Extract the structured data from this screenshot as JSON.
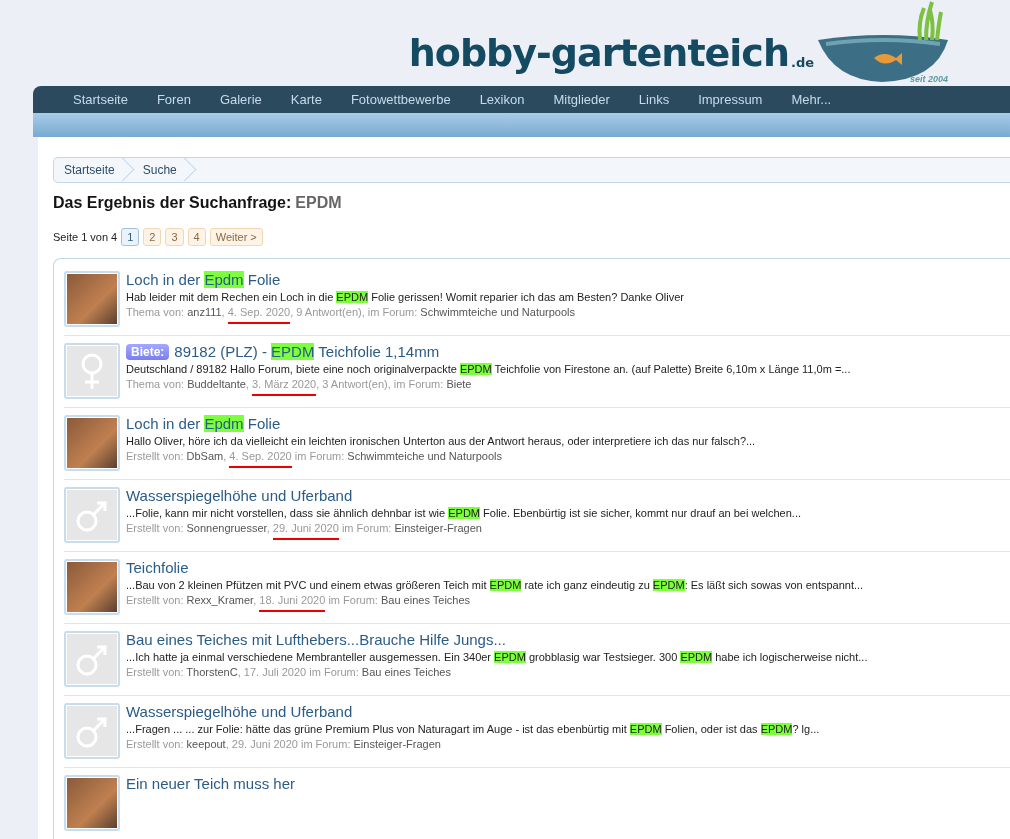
{
  "logo": {
    "name": "hobby-gartenteich",
    "tld": ".de",
    "since": "seit 2004"
  },
  "nav": [
    "Startseite",
    "Foren",
    "Galerie",
    "Karte",
    "Fotowettbewerbe",
    "Lexikon",
    "Mitglieder",
    "Links",
    "Impressum",
    "Mehr..."
  ],
  "breadcrumb": [
    "Startseite",
    "Suche"
  ],
  "heading": {
    "label": "Das Ergebnis der Suchanfrage:",
    "query": "EPDM"
  },
  "pagination": {
    "label": "Seite 1 von 4",
    "pages": [
      {
        "label": "1",
        "selected": true
      },
      {
        "label": "2",
        "selected": false
      },
      {
        "label": "3",
        "selected": false
      },
      {
        "label": "4",
        "selected": false
      }
    ],
    "next": "Weiter >"
  },
  "results": [
    {
      "kind": "photo",
      "title": [
        {
          "text": "Loch in der ",
          "highlight": false
        },
        {
          "text": "Epdm",
          "highlight": true
        },
        {
          "text": " Folie",
          "highlight": false
        }
      ],
      "snippet": [
        {
          "text": "Hab leider mit dem Rechen ein Loch in die ",
          "highlight": false
        },
        {
          "text": "EPDM",
          "highlight": true
        },
        {
          "text": " Folie gerissen! Womit reparier ich das am Besten? Danke Oliver",
          "highlight": false
        }
      ],
      "meta": [
        {
          "kind": "label",
          "text": "Thema von: "
        },
        {
          "kind": "user",
          "text": "anz111"
        },
        {
          "kind": "label",
          "text": ", "
        },
        {
          "kind": "date",
          "text": "4. Sep. 2020",
          "underlined": true
        },
        {
          "kind": "label",
          "text": ", 9 Antwort(en), im Forum: "
        },
        {
          "kind": "forum",
          "text": "Schwimmteiche und Naturpools"
        }
      ]
    },
    {
      "kind": "female",
      "badge": "Biete:",
      "title": [
        {
          "text": "89182 (PLZ) - ",
          "highlight": false
        },
        {
          "text": "EPDM",
          "highlight": true
        },
        {
          "text": " Teichfolie 1,14mm",
          "highlight": false
        }
      ],
      "snippet": [
        {
          "text": "Deutschland / 89182 Hallo Forum, biete eine noch originalverpackte ",
          "highlight": false
        },
        {
          "text": "EPDM",
          "highlight": true
        },
        {
          "text": " Teichfolie von Firestone an. (auf Palette) Breite 6,10m x Länge 11,0m =...",
          "highlight": false
        }
      ],
      "meta": [
        {
          "kind": "label",
          "text": "Thema von: "
        },
        {
          "kind": "user",
          "text": "Buddeltante"
        },
        {
          "kind": "label",
          "text": ", "
        },
        {
          "kind": "date",
          "text": "3. März 2020",
          "underlined": true
        },
        {
          "kind": "label",
          "text": ", 3 Antwort(en), im Forum: "
        },
        {
          "kind": "forum",
          "text": "Biete"
        }
      ]
    },
    {
      "kind": "photo",
      "title": [
        {
          "text": "Loch in der ",
          "highlight": false
        },
        {
          "text": "Epdm",
          "highlight": true
        },
        {
          "text": " Folie",
          "highlight": false
        }
      ],
      "snippet": [
        {
          "text": "Hallo Oliver, höre ich da vielleicht ein leichten ironischen Unterton aus der Antwort heraus, oder interpretiere ich das nur falsch?...",
          "highlight": false
        }
      ],
      "meta": [
        {
          "kind": "label",
          "text": "Erstellt von: "
        },
        {
          "kind": "user",
          "text": "DbSam"
        },
        {
          "kind": "label",
          "text": ", "
        },
        {
          "kind": "date",
          "text": "4. Sep. 2020",
          "underlined": true
        },
        {
          "kind": "label",
          "text": " im Forum: "
        },
        {
          "kind": "forum",
          "text": "Schwimmteiche und Naturpools"
        }
      ]
    },
    {
      "kind": "male",
      "title": [
        {
          "text": "Wasserspiegelhöhe und Uferband",
          "highlight": false
        }
      ],
      "snippet": [
        {
          "text": "...Folie, kann mir nicht vorstellen, dass sie ähnlich dehnbar ist wie ",
          "highlight": false
        },
        {
          "text": "EPDM",
          "highlight": true
        },
        {
          "text": " Folie. Ebenbürtig ist sie sicher, kommt nur drauf an bei welchen...",
          "highlight": false
        }
      ],
      "meta": [
        {
          "kind": "label",
          "text": "Erstellt von: "
        },
        {
          "kind": "user",
          "text": "Sonnengruesser"
        },
        {
          "kind": "label",
          "text": ", "
        },
        {
          "kind": "date",
          "text": "29. Juni 2020",
          "underlined": true
        },
        {
          "kind": "label",
          "text": " im Forum: "
        },
        {
          "kind": "forum",
          "text": "Einsteiger-Fragen"
        }
      ]
    },
    {
      "kind": "photo",
      "title": [
        {
          "text": "Teichfolie",
          "highlight": false
        }
      ],
      "snippet": [
        {
          "text": "...Bau von 2 kleinen Pfützen mit PVC und einem etwas größeren Teich mit ",
          "highlight": false
        },
        {
          "text": "EPDM",
          "highlight": true
        },
        {
          "text": " rate ich ganz eindeutig zu ",
          "highlight": false
        },
        {
          "text": "EPDM",
          "highlight": true
        },
        {
          "text": ": Es läßt sich sowas von entspannt...",
          "highlight": false
        }
      ],
      "meta": [
        {
          "kind": "label",
          "text": "Erstellt von: "
        },
        {
          "kind": "user",
          "text": "Rexx_Kramer"
        },
        {
          "kind": "label",
          "text": ", "
        },
        {
          "kind": "date",
          "text": "18. Juni 2020",
          "underlined": true
        },
        {
          "kind": "label",
          "text": " im Forum: "
        },
        {
          "kind": "forum",
          "text": "Bau eines Teiches"
        }
      ]
    },
    {
      "kind": "male",
      "title": [
        {
          "text": "Bau eines Teiches mit Lufthebers...Brauche Hilfe Jungs...",
          "highlight": false
        }
      ],
      "snippet": [
        {
          "text": "...Ich hatte ja einmal verschiedene Membranteller ausgemessen. Ein 340er ",
          "highlight": false
        },
        {
          "text": "EPDM",
          "highlight": true
        },
        {
          "text": " grobblasig war Testsieger. 300 ",
          "highlight": false
        },
        {
          "text": "EPDM",
          "highlight": true
        },
        {
          "text": " habe ich logischerweise nicht...",
          "highlight": false
        }
      ],
      "meta": [
        {
          "kind": "label",
          "text": "Erstellt von: "
        },
        {
          "kind": "user",
          "text": "ThorstenC"
        },
        {
          "kind": "label",
          "text": ", "
        },
        {
          "kind": "date",
          "text": "17. Juli 2020",
          "underlined": false
        },
        {
          "kind": "label",
          "text": " im Forum: "
        },
        {
          "kind": "forum",
          "text": "Bau eines Teiches"
        }
      ]
    },
    {
      "kind": "male",
      "title": [
        {
          "text": "Wasserspiegelhöhe und Uferband",
          "highlight": false
        }
      ],
      "snippet": [
        {
          "text": "...Fragen ... ... zur Folie: hätte das grüne Premium Plus von Naturagart im Auge - ist das ebenbürtig mit ",
          "highlight": false
        },
        {
          "text": "EPDM",
          "highlight": true
        },
        {
          "text": " Folien, oder ist das ",
          "highlight": false
        },
        {
          "text": "EPDM",
          "highlight": true
        },
        {
          "text": "? lg...",
          "highlight": false
        }
      ],
      "meta": [
        {
          "kind": "label",
          "text": "Erstellt von: "
        },
        {
          "kind": "user",
          "text": "keepout"
        },
        {
          "kind": "label",
          "text": ", "
        },
        {
          "kind": "date",
          "text": "29. Juni 2020",
          "underlined": false
        },
        {
          "kind": "label",
          "text": " im Forum: "
        },
        {
          "kind": "forum",
          "text": "Einsteiger-Fragen"
        }
      ]
    },
    {
      "kind": "photo",
      "title": [
        {
          "text": "Ein neuer Teich muss her",
          "highlight": false
        }
      ]
    }
  ]
}
